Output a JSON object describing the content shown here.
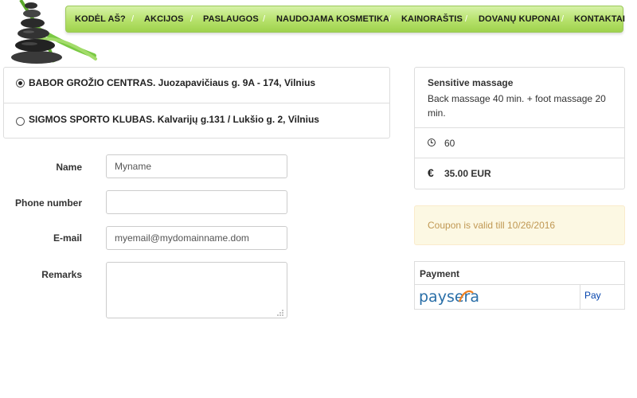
{
  "brand": {
    "accent": "#a6d957",
    "link_color": "#0645ad",
    "warning_text": "#c09853",
    "warning_bg": "#fcf8e3"
  },
  "nav": {
    "items": [
      {
        "label": "KODĖL AŠ?"
      },
      {
        "label": "AKCIJOS"
      },
      {
        "label": "PASLAUGOS"
      },
      {
        "label": "NAUDOJAMA KOSMETIKA"
      },
      {
        "label": "KAINORAŠTIS"
      },
      {
        "label": "DOVANŲ KUPONAI"
      },
      {
        "label": "KONTAKTAI"
      }
    ],
    "separator": "/"
  },
  "locations": [
    {
      "label": "BABOR GROŽIO CENTRAS. Juozapavičiaus g. 9A - 174, Vilnius",
      "selected": true
    },
    {
      "label": "SIGMOS SPORTO KLUBAS. Kalvarijų g.131 / Lukšio g. 2, Vilnius",
      "selected": false
    }
  ],
  "form": {
    "name": {
      "label": "Name",
      "value": "Myname"
    },
    "phone": {
      "label": "Phone number",
      "value": ""
    },
    "email": {
      "label": "E-mail",
      "value": "myemail@mydomainname.dom"
    },
    "remarks": {
      "label": "Remarks",
      "value": ""
    }
  },
  "service": {
    "title": "Sensitive massage",
    "description": "Back massage 40 min. + foot massage 20 min.",
    "duration": "60",
    "duration_icon": "clock-icon",
    "price": "35.00 EUR",
    "price_icon": "euro-icon",
    "euro_symbol": "€"
  },
  "coupon": {
    "message": "Coupon is valid till 10/26/2016"
  },
  "payment": {
    "heading": "Payment",
    "provider": "paysera",
    "pay_label": "Pay"
  }
}
